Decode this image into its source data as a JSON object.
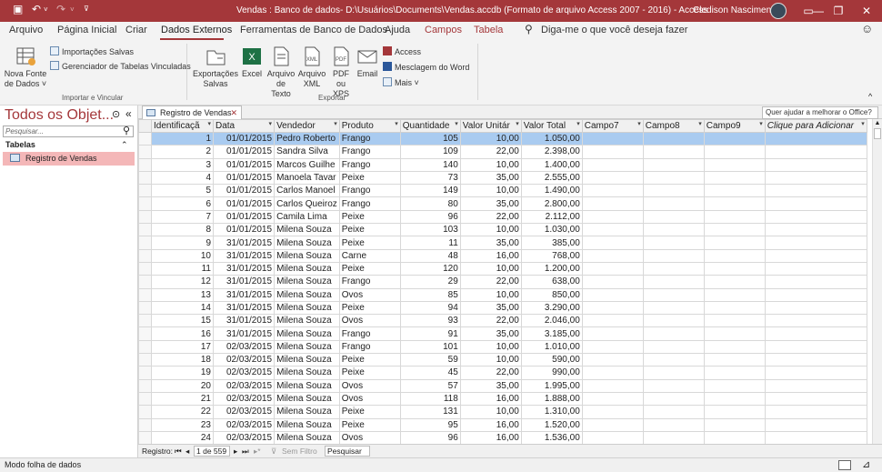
{
  "titlebar": {
    "title": "Vendas : Banco de dados- D:\\Usuários\\Documents\\Vendas.accdb (Formato de arquivo Access 2007 - 2016)  -  Access",
    "user": "Cledison Nascimento",
    "save_icon": "save-icon",
    "undo_icon": "undo-icon",
    "redo_icon": "redo-icon",
    "minimize": "—",
    "restore": "❐",
    "close": "✕",
    "brand_color": "#a4373a"
  },
  "menu": {
    "tabs": [
      "Arquivo",
      "Página Inicial",
      "Criar",
      "Dados Externos",
      "Ferramentas de Banco de Dados",
      "Ajuda",
      "Campos",
      "Tabela"
    ],
    "tell_me": "Diga-me o que você deseja fazer",
    "smiley": "☺"
  },
  "ribbon": {
    "nova_fonte_1": "Nova Fonte",
    "nova_fonte_2": "de Dados ˅",
    "importacoes": "Importações Salvas",
    "gerenciador": "Gerenciador de Tabelas Vinculadas",
    "group_importar": "Importar e Vincular",
    "exportacoes_1": "Exportações",
    "exportacoes_2": "Salvas",
    "excel": "Excel",
    "arquivo_texto_1": "Arquivo",
    "arquivo_texto_2": "de Texto",
    "arquivo_xml_1": "Arquivo",
    "arquivo_xml_2": "XML",
    "pdf_1": "PDF",
    "pdf_2": "ou XPS",
    "email": "Email",
    "access": "Access",
    "mesclagem": "Mesclagem do Word",
    "mais": "Mais ˅",
    "group_exportar": "Exportar",
    "collapse": "^"
  },
  "nav": {
    "title": "Todos os Objet...",
    "search_placeholder": "Pesquisar...",
    "section": "Tabelas",
    "item": "Registro de Vendas"
  },
  "doc": {
    "tab": "Registro de Vendas",
    "help": "Quer ajudar a melhorar o Office?"
  },
  "table": {
    "columns": [
      "Identificaçã",
      "Data",
      "Vendedor",
      "Produto",
      "Quantidade",
      "Valor Unitár",
      "Valor Total",
      "Campo7",
      "Campo8",
      "Campo9",
      "Clique para Adicionar"
    ],
    "rows": [
      [
        "1",
        "01/01/2015",
        "Pedro Roberto",
        "Frango",
        "105",
        "10,00",
        "1.050,00"
      ],
      [
        "2",
        "01/01/2015",
        "Sandra Silva",
        "Frango",
        "109",
        "22,00",
        "2.398,00"
      ],
      [
        "3",
        "01/01/2015",
        "Marcos Guilhe",
        "Frango",
        "140",
        "10,00",
        "1.400,00"
      ],
      [
        "4",
        "01/01/2015",
        "Manoela Tavar",
        "Peixe",
        "73",
        "35,00",
        "2.555,00"
      ],
      [
        "5",
        "01/01/2015",
        "Carlos Manoel",
        "Frango",
        "149",
        "10,00",
        "1.490,00"
      ],
      [
        "6",
        "01/01/2015",
        "Carlos Queiroz",
        "Frango",
        "80",
        "35,00",
        "2.800,00"
      ],
      [
        "7",
        "01/01/2015",
        "Camila Lima",
        "Peixe",
        "96",
        "22,00",
        "2.112,00"
      ],
      [
        "8",
        "01/01/2015",
        "Milena Souza",
        "Peixe",
        "103",
        "10,00",
        "1.030,00"
      ],
      [
        "9",
        "31/01/2015",
        "Milena Souza",
        "Peixe",
        "11",
        "35,00",
        "385,00"
      ],
      [
        "10",
        "31/01/2015",
        "Milena Souza",
        "Carne",
        "48",
        "16,00",
        "768,00"
      ],
      [
        "11",
        "31/01/2015",
        "Milena Souza",
        "Peixe",
        "120",
        "10,00",
        "1.200,00"
      ],
      [
        "12",
        "31/01/2015",
        "Milena Souza",
        "Frango",
        "29",
        "22,00",
        "638,00"
      ],
      [
        "13",
        "31/01/2015",
        "Milena Souza",
        "Ovos",
        "85",
        "10,00",
        "850,00"
      ],
      [
        "14",
        "31/01/2015",
        "Milena Souza",
        "Peixe",
        "94",
        "35,00",
        "3.290,00"
      ],
      [
        "15",
        "31/01/2015",
        "Milena Souza",
        "Ovos",
        "93",
        "22,00",
        "2.046,00"
      ],
      [
        "16",
        "31/01/2015",
        "Milena Souza",
        "Frango",
        "91",
        "35,00",
        "3.185,00"
      ],
      [
        "17",
        "02/03/2015",
        "Milena Souza",
        "Frango",
        "101",
        "10,00",
        "1.010,00"
      ],
      [
        "18",
        "02/03/2015",
        "Milena Souza",
        "Peixe",
        "59",
        "10,00",
        "590,00"
      ],
      [
        "19",
        "02/03/2015",
        "Milena Souza",
        "Peixe",
        "45",
        "22,00",
        "990,00"
      ],
      [
        "20",
        "02/03/2015",
        "Milena Souza",
        "Ovos",
        "57",
        "35,00",
        "1.995,00"
      ],
      [
        "21",
        "02/03/2015",
        "Milena Souza",
        "Ovos",
        "118",
        "16,00",
        "1.888,00"
      ],
      [
        "22",
        "02/03/2015",
        "Milena Souza",
        "Peixe",
        "131",
        "10,00",
        "1.310,00"
      ],
      [
        "23",
        "02/03/2015",
        "Milena Souza",
        "Peixe",
        "95",
        "16,00",
        "1.520,00"
      ],
      [
        "24",
        "02/03/2015",
        "Milena Souza",
        "Ovos",
        "96",
        "16,00",
        "1.536,00"
      ]
    ],
    "current_row": 0
  },
  "recordbar": {
    "label": "Registro:",
    "position": "1 de 559",
    "filter": "Sem Filtro",
    "search": "Pesquisar"
  },
  "status": {
    "text": "Modo folha de dados"
  }
}
